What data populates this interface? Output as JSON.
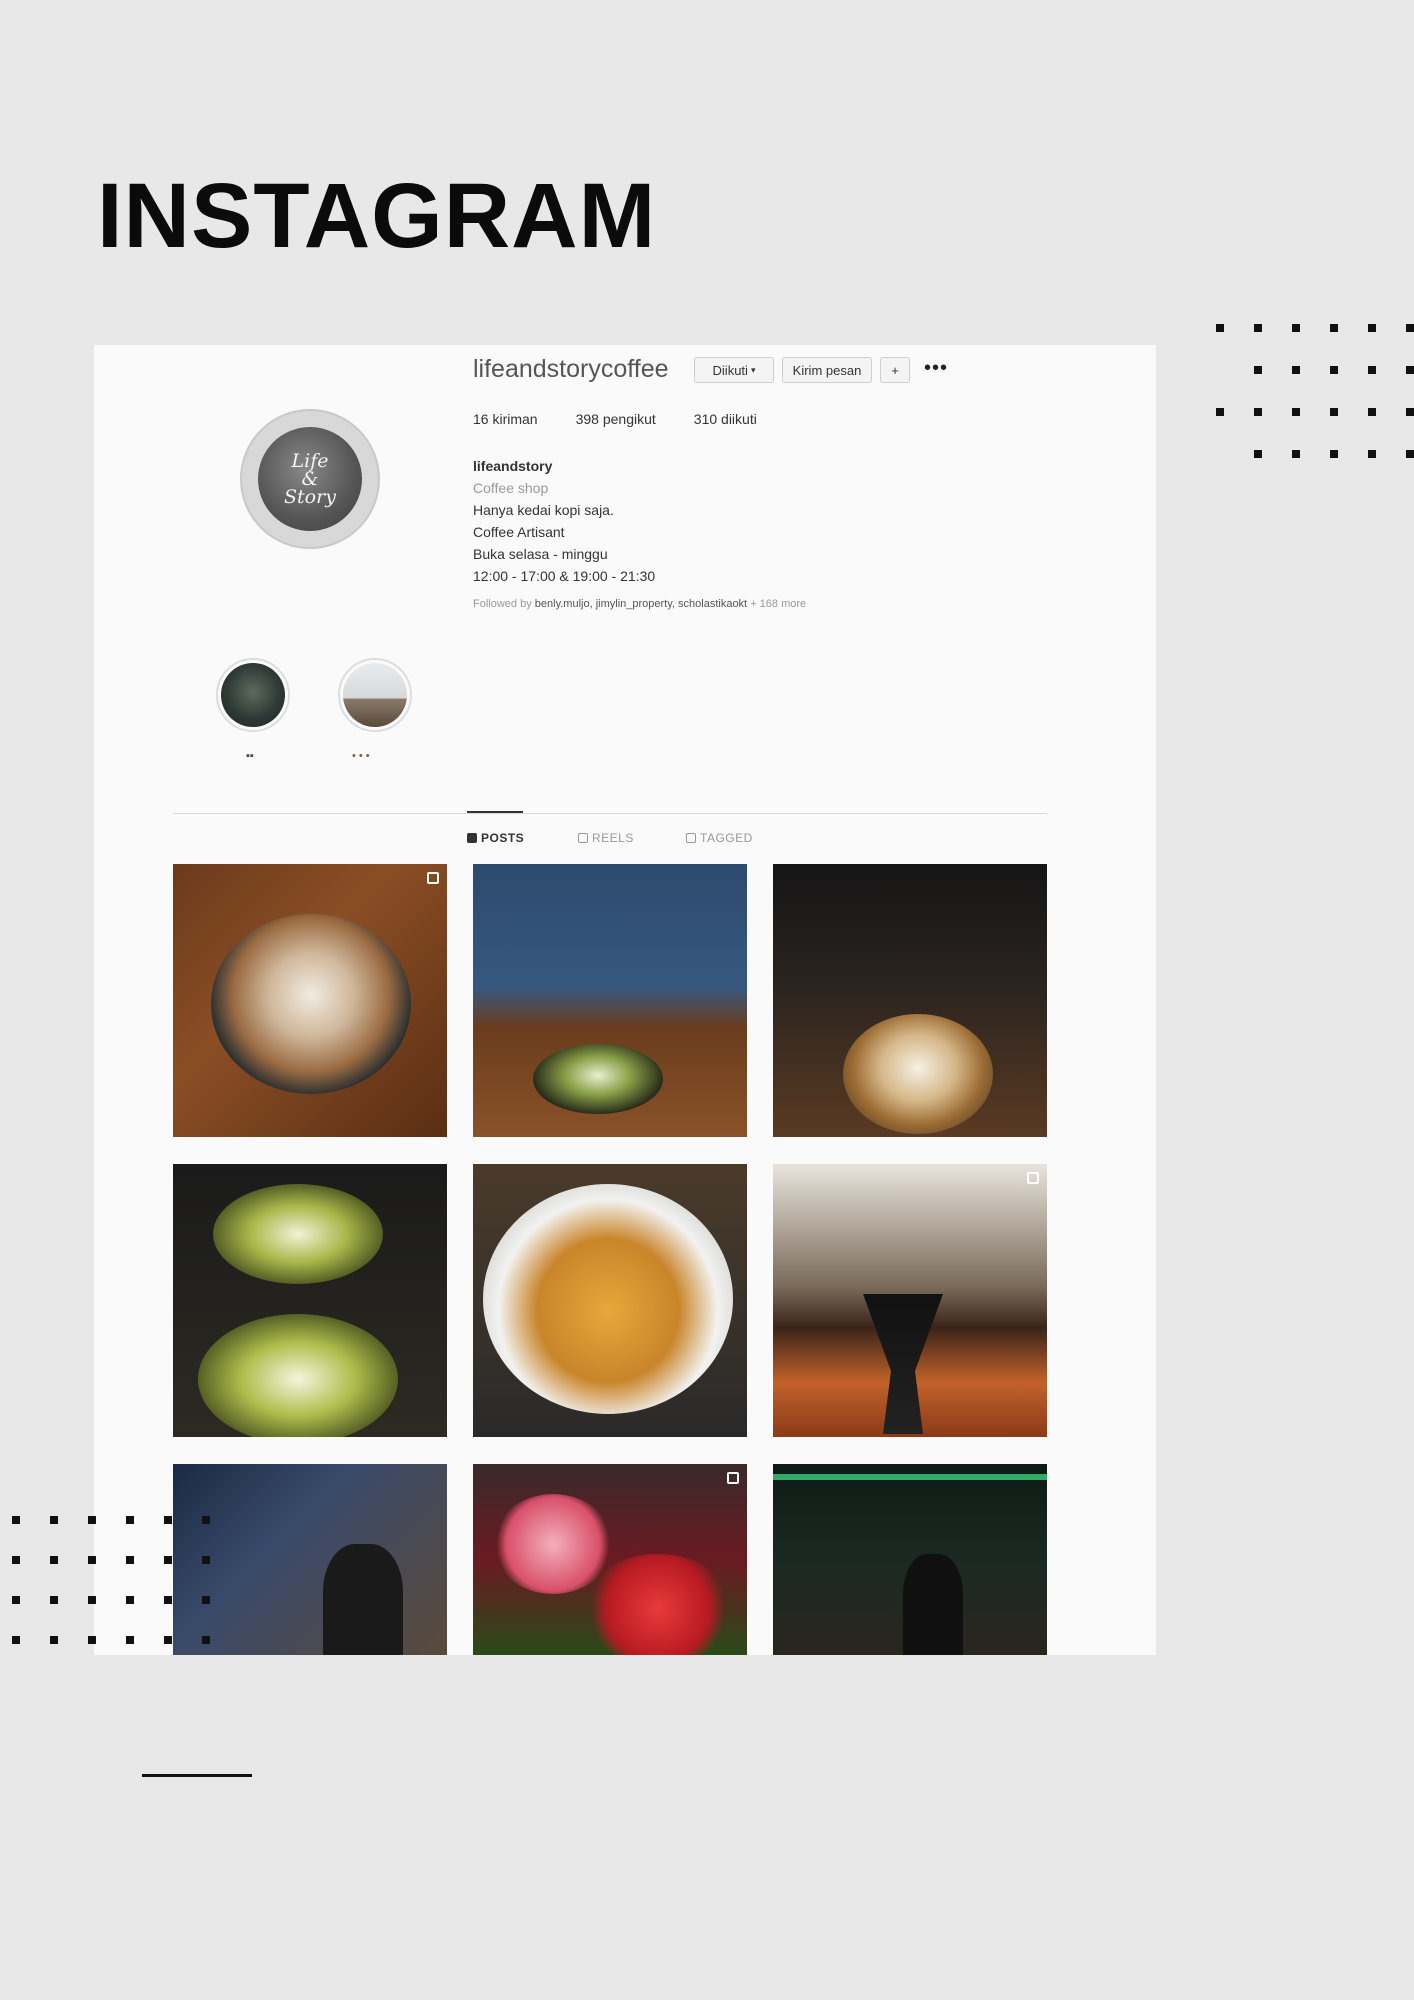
{
  "page": {
    "heading": "INSTAGRAM"
  },
  "profile": {
    "username": "lifeandstorycoffee",
    "buttons": {
      "following": "Diikuti",
      "message": "Kirim pesan",
      "suggest": "+"
    },
    "more": "•••",
    "stats": {
      "posts": "16 kiriman",
      "followers": "398 pengikut",
      "following": "310 diikuti"
    },
    "bio": {
      "name": "lifeandstory",
      "category": "Coffee shop",
      "lines": [
        "Hanya kedai kopi saja.",
        "Coffee Artisant",
        "Buka selasa - minggu",
        "12:00 - 17:00 & 19:00 - 21:30"
      ]
    },
    "followed_by": {
      "prefix": "Followed by",
      "names": "benly.muljo, jimylin_property, scholastikaokt",
      "more": "+ 168 more"
    },
    "avatar_text": [
      "Life",
      "&",
      "Story"
    ]
  },
  "highlights": [
    {
      "label": "▪▪"
    },
    {
      "label": "•••"
    }
  ],
  "tabs": [
    "POSTS",
    "REELS",
    "TAGGED"
  ],
  "posts": [
    {
      "name": "latte-swan-wood-table",
      "multi": true
    },
    {
      "name": "green-tea-latte-plant",
      "multi": false
    },
    {
      "name": "latte-swan-dark",
      "multi": false
    },
    {
      "name": "two-matcha-lattes",
      "multi": false
    },
    {
      "name": "espresso-pour",
      "multi": false
    },
    {
      "name": "pour-over-dripper",
      "multi": true
    },
    {
      "name": "friends-at-cafe",
      "multi": false
    },
    {
      "name": "red-pink-flowers",
      "multi": true
    },
    {
      "name": "barista-at-bar",
      "multi": false
    }
  ]
}
